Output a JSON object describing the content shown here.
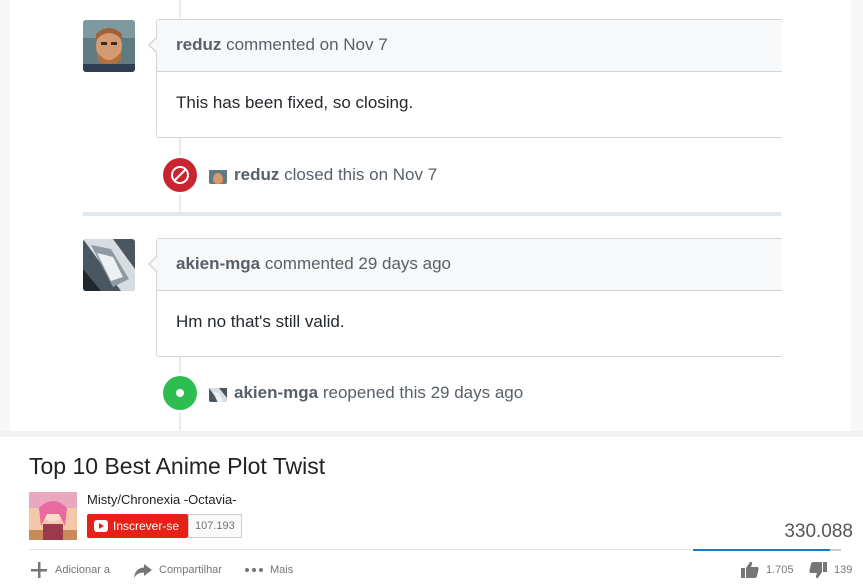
{
  "timeline": {
    "comments": [
      {
        "author": "reduz",
        "meta": "commented on Nov 7",
        "body": "This has been fixed, so closing."
      },
      {
        "author": "akien-mga",
        "meta": "commented 29 days ago",
        "body": "Hm no that's still valid."
      }
    ],
    "events": [
      {
        "type": "closed",
        "actor": "reduz",
        "text": "closed this on Nov 7",
        "color": "#cb2431",
        "icon": "circle-slash-icon"
      },
      {
        "type": "reopened",
        "actor": "akien-mga",
        "text": "reopened this 29 days ago",
        "color": "#2cbe4e",
        "icon": "dot-fill-icon"
      }
    ]
  },
  "video": {
    "title": "Top 10 Best Anime Plot Twist",
    "channel": "Misty/Chronexia -Octavia-",
    "subscribe_label": "Inscrever-se",
    "subscriber_count": "107.193",
    "view_count": "330.088",
    "actions": {
      "add_to": "Adicionar a",
      "share": "Compartilhar",
      "more": "Mais"
    },
    "likes": "1.705",
    "dislikes": "139",
    "like_ratio": 0.925,
    "colors": {
      "subscribe": "#e62117",
      "ratio_bar": "#167ac6"
    }
  }
}
